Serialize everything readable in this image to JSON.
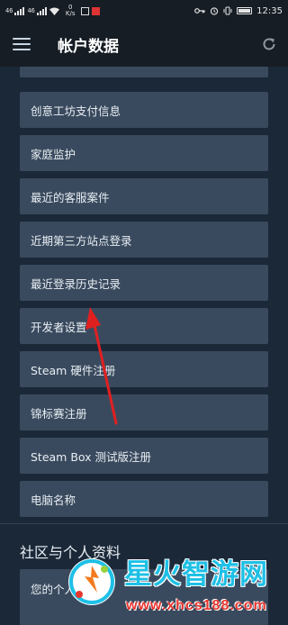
{
  "status_bar": {
    "signal_text_1": "46",
    "signal_text_2": "46",
    "net_speed_value": "0",
    "net_speed_unit": "K/s",
    "time": "12:35"
  },
  "app_bar": {
    "title": "帐户数据"
  },
  "menu_items": [
    {
      "label": "创意工坊支付信息"
    },
    {
      "label": "家庭监护"
    },
    {
      "label": "最近的客服案件"
    },
    {
      "label": "近期第三方站点登录"
    },
    {
      "label": "最近登录历史记录"
    },
    {
      "label": "开发者设置"
    },
    {
      "label": "Steam 硬件注册"
    },
    {
      "label": "锦标赛注册"
    },
    {
      "label": "Steam Box 测试版注册"
    },
    {
      "label": "电脑名称"
    }
  ],
  "section": {
    "title": "社区与个人资料",
    "first_item_label": "您的个人资料"
  },
  "annotation": {
    "color": "#e02020"
  },
  "watermark": {
    "title": "星火智游网",
    "url": "www.xhcs188.com",
    "title_color": "#1ec0e6",
    "url_color": "#e8352e"
  },
  "colors": {
    "background": "#1b2838",
    "appbar": "#171d25",
    "item": "#3a4a5e"
  }
}
